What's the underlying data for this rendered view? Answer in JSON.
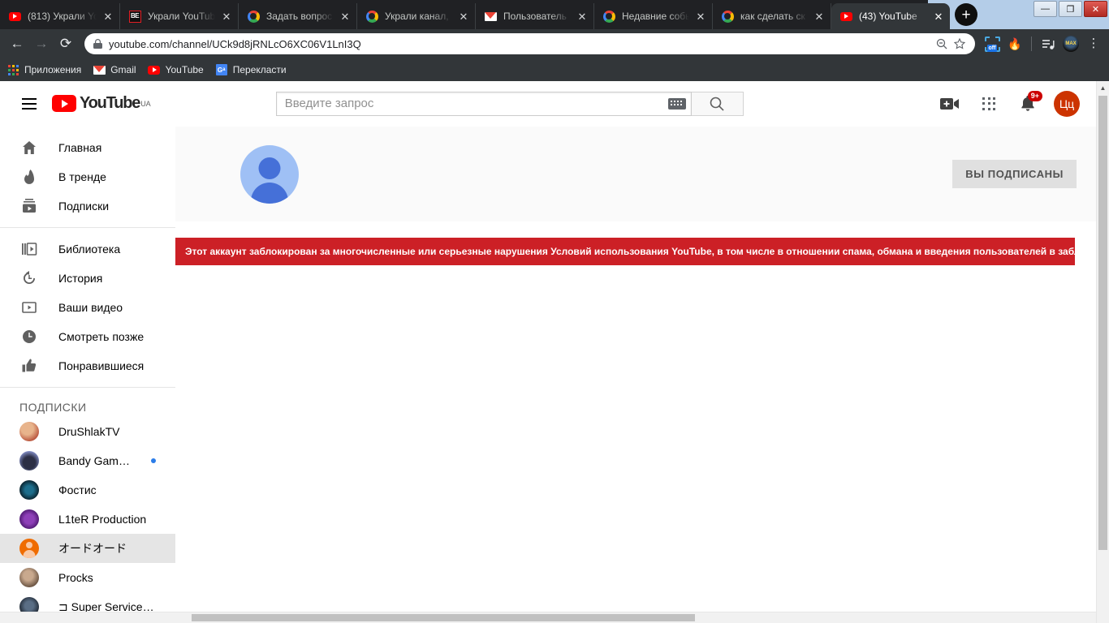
{
  "browser": {
    "tabs": [
      {
        "title": "(813) Украли Yo",
        "favicon": "youtube-icon",
        "active": false
      },
      {
        "title": "Украли YouTub",
        "favicon": "be-icon",
        "active": false
      },
      {
        "title": "Задать вопрос",
        "favicon": "google-icon",
        "active": false
      },
      {
        "title": "Украли канал, ",
        "favicon": "google-icon",
        "active": false
      },
      {
        "title": "Пользователь",
        "favicon": "gmail-icon",
        "active": false
      },
      {
        "title": "Недавние собы",
        "favicon": "google-icon",
        "active": false
      },
      {
        "title": "как сделать ск",
        "favicon": "google-icon",
        "active": false
      },
      {
        "title": "(43) YouTube",
        "favicon": "youtube-icon",
        "active": true
      }
    ],
    "new_tab_label": "+",
    "tab_close_label": "✕",
    "window_controls": {
      "minimize": "—",
      "maximize": "❐",
      "close": "✕"
    },
    "nav": {
      "back": "←",
      "forward": "→",
      "reload": "⟳"
    },
    "omnibox": {
      "url": "youtube.com/channel/UCk9d8jRNLcO6XC06V1LnI3Q",
      "lock_icon": "lock-icon",
      "zoom_icon": "zoom-out-icon",
      "bookmark_icon": "star-icon"
    },
    "extensions": [
      {
        "name": "censor-tracking-off-extension",
        "label": "off"
      },
      {
        "name": "fire-extension",
        "glyph": "🔥"
      },
      {
        "name": "playlist-extension",
        "glyph": "≡♪"
      },
      {
        "name": "profile-avatar",
        "label": "MAX"
      },
      {
        "name": "chrome-menu",
        "glyph": "⋮"
      }
    ],
    "bookmarks": [
      {
        "label": "Приложения",
        "icon": "apps-grid-icon"
      },
      {
        "label": "Gmail",
        "icon": "gmail-icon"
      },
      {
        "label": "YouTube",
        "icon": "youtube-icon"
      },
      {
        "label": "Перекласти",
        "icon": "translate-icon"
      }
    ]
  },
  "youtube": {
    "logo_text": "YouTube",
    "logo_country": "UA",
    "search": {
      "placeholder": "Введите запрос",
      "button_icon": "search-icon",
      "keyboard_icon": "keyboard-icon"
    },
    "header_actions": {
      "create_video_icon": "video-camera-plus-icon",
      "apps_icon": "apps-grid-icon",
      "notifications_icon": "bell-icon",
      "notifications_badge": "9+",
      "avatar_initials": "Цц"
    },
    "sidebar": {
      "primary": [
        {
          "label": "Главная",
          "icon": "home-icon"
        },
        {
          "label": "В тренде",
          "icon": "trending-flame-icon"
        },
        {
          "label": "Подписки",
          "icon": "subscriptions-icon"
        }
      ],
      "library": [
        {
          "label": "Библиотека",
          "icon": "library-icon"
        },
        {
          "label": "История",
          "icon": "history-clock-icon"
        },
        {
          "label": "Ваши видео",
          "icon": "your-videos-icon"
        },
        {
          "label": "Смотреть позже",
          "icon": "watch-later-clock-icon"
        },
        {
          "label": "Понравившиеся",
          "icon": "thumbs-up-icon"
        }
      ],
      "subscriptions_title": "ПОДПИСКИ",
      "subscriptions": [
        {
          "label": "DruShlakTV",
          "avatar_color": "#d98c6a",
          "new": false
        },
        {
          "label": "Bandy Gameplay",
          "avatar_color": "#8b9fe0",
          "new": true
        },
        {
          "label": "Фостис",
          "avatar_color": "#12303c",
          "new": false
        },
        {
          "label": "L1teR Production",
          "avatar_color": "#6b2f8f",
          "new": false
        },
        {
          "label": "オードオード",
          "avatar_color": "#ef6c00",
          "new": false,
          "selected": true
        },
        {
          "label": "Procks",
          "avatar_color": "#9b7b6b",
          "new": false
        },
        {
          "label": "⊐ Super Service Wall…",
          "avatar_color": "#2f3a4a",
          "new": false
        }
      ]
    },
    "channel": {
      "avatar_icon": "default-user-avatar",
      "subscribe_button": "ВЫ ПОДПИСАНЫ",
      "ban_notice": "Этот аккаунт заблокирован за многочисленные или серьезные нарушения Условий использования YouTube, в том числе в отношении спама, обмана и введения пользователей в заблуждение.",
      "ban_color": "#cc2026"
    }
  }
}
